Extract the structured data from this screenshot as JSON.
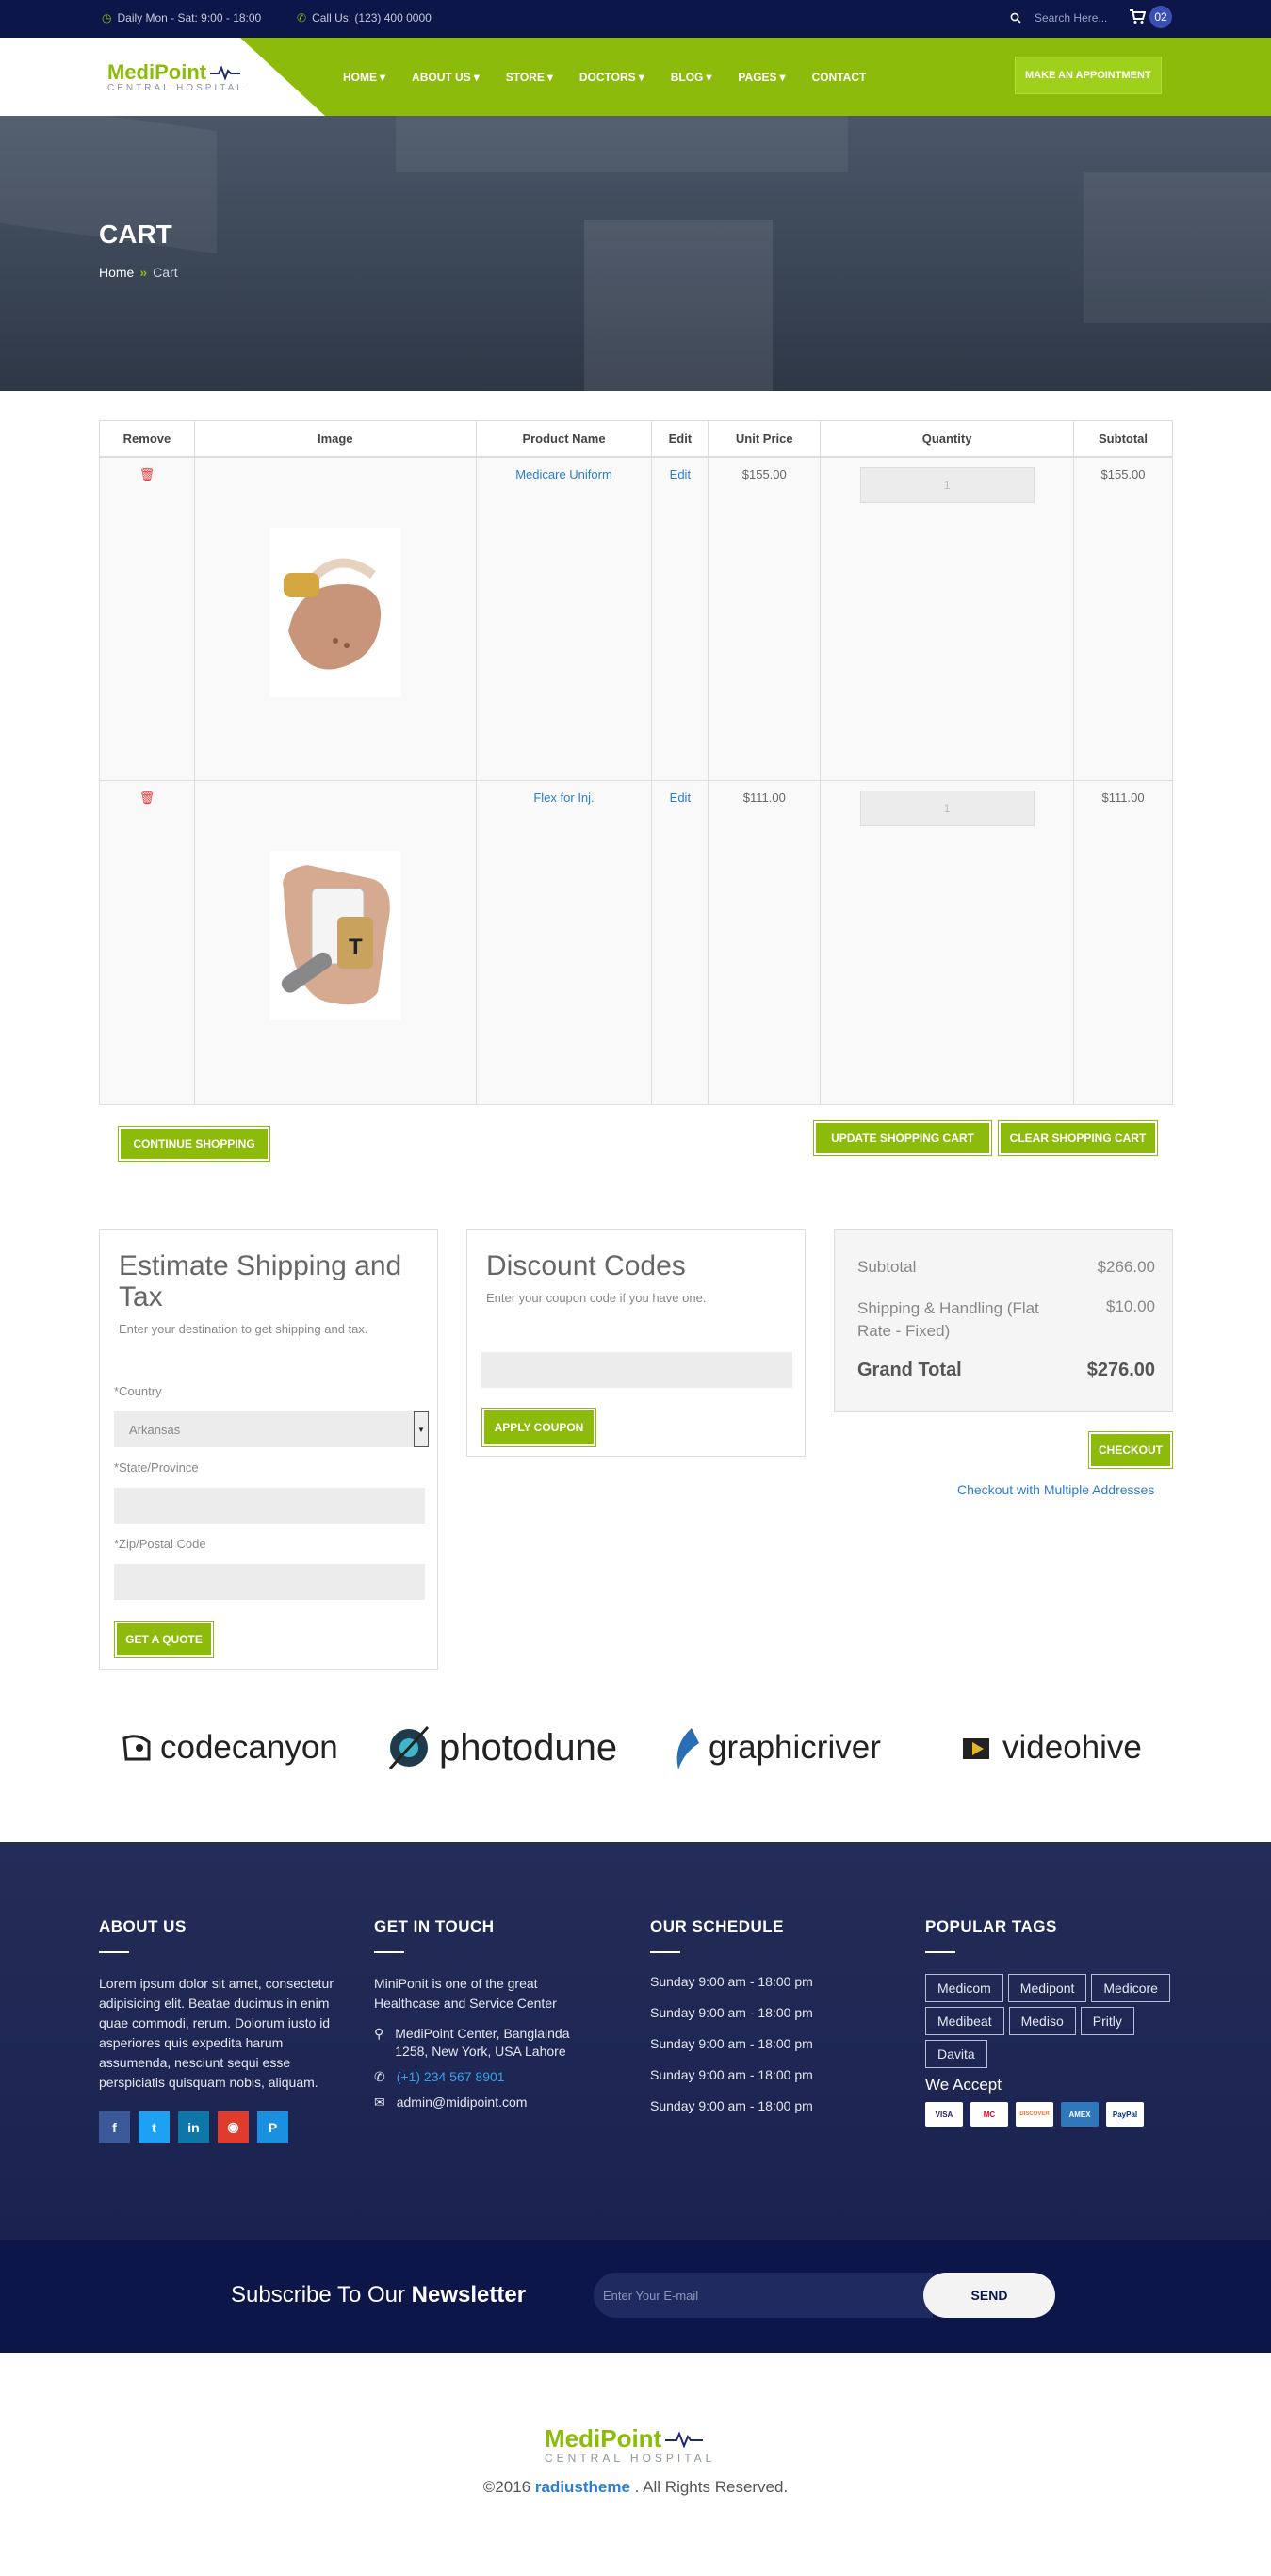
{
  "topbar": {
    "hours": "Daily Mon - Sat: 9:00 - 18:00",
    "call": "Call Us: (123) 400 0000",
    "search_placeholder": "Search Here...",
    "cart_count": "02"
  },
  "brand": {
    "name": "MediPoint",
    "subtitle": "CENTRAL HOSPITAL"
  },
  "nav": {
    "items": [
      "HOME",
      "ABOUT US",
      "STORE",
      "DOCTORS",
      "BLOG",
      "PAGES",
      "CONTACT"
    ],
    "cta": "MAKE AN APPOINTMENT"
  },
  "hero": {
    "title": "CART",
    "breadcrumb_home": "Home",
    "breadcrumb_current": "Cart"
  },
  "cart": {
    "headers": [
      "Remove",
      "Image",
      "Product Name",
      "Edit",
      "Unit Price",
      "Quantity",
      "Subtotal"
    ],
    "rows": [
      {
        "name": "Medicare Uniform",
        "edit": "Edit",
        "price": "$155.00",
        "qty": "1",
        "subtotal": "$155.00"
      },
      {
        "name": "Flex for Inj.",
        "edit": "Edit",
        "price": "$111.00",
        "qty": "1",
        "subtotal": "$111.00"
      }
    ],
    "continue_label": "CONTINUE SHOPPING",
    "update_label": "UPDATE SHOPPING CART",
    "clear_label": "CLEAR SHOPPING CART"
  },
  "shipping": {
    "title": "Estimate Shipping and Tax",
    "subtitle": "Enter your destination to get shipping and tax.",
    "country_label": "*Country",
    "country_value": "Arkansas",
    "state_label": "*State/Province",
    "zip_label": "*Zip/Postal Code",
    "quote_label": "GET A QUOTE"
  },
  "discount": {
    "title": "Discount Codes",
    "subtitle": "Enter your coupon code if you have one.",
    "apply_label": "APPLY COUPON"
  },
  "totals": {
    "subtotal_label": "Subtotal",
    "subtotal_value": "$266.00",
    "shipping_label": "Shipping & Handling (Flat Rate - Fixed)",
    "shipping_value": "$10.00",
    "grand_label": "Grand Total",
    "grand_value": "$276.00",
    "checkout_label": "CHECKOUT",
    "multi_label": "Checkout with Multiple Addresses"
  },
  "brands": [
    "codecanyon",
    "photodune",
    "graphicriver",
    "videohive"
  ],
  "footer": {
    "about_title": "ABOUT US",
    "about_text": "Lorem ipsum dolor sit amet, consectetur adipisicing elit. Beatae ducimus in enim quae commodi, rerum. Dolorum iusto id asperiores quis expedita harum assumenda, nesciunt sequi esse perspiciatis quisquam nobis, aliquam.",
    "touch_title": "GET IN TOUCH",
    "touch_text": "MiniPonit is one of the great Healthcase and Service Center",
    "address": "MediPoint Center, Banglainda 1258, New York, USA Lahore",
    "phone": "(+1) 234 567 8901",
    "email": "admin@midipoint.com",
    "schedule_title": "OUR SCHEDULE",
    "schedule": [
      "Sunday 9:00 am - 18:00 pm",
      "Sunday 9:00 am - 18:00 pm",
      "Sunday 9:00 am - 18:00 pm",
      "Sunday 9:00 am - 18:00 pm",
      "Sunday 9:00 am - 18:00 pm"
    ],
    "tags_title": "POPULAR TAGS",
    "tags": [
      "Medicom",
      "Medipont",
      "Medicore",
      "Medibeat",
      "Mediso",
      "Pritly",
      "Davita"
    ],
    "accept_title": "We Accept",
    "cards": [
      "VISA",
      "MC",
      "DISCOVER",
      "AMEX",
      "PayPal"
    ]
  },
  "newsletter": {
    "title_light": "Subscribe To Our ",
    "title_bold": "Newsletter",
    "placeholder": "Enter Your E-mail",
    "send_label": "SEND"
  },
  "copyright": {
    "prefix": "©2016 ",
    "brand": "radiustheme",
    "suffix": " . All Rights Reserved."
  }
}
